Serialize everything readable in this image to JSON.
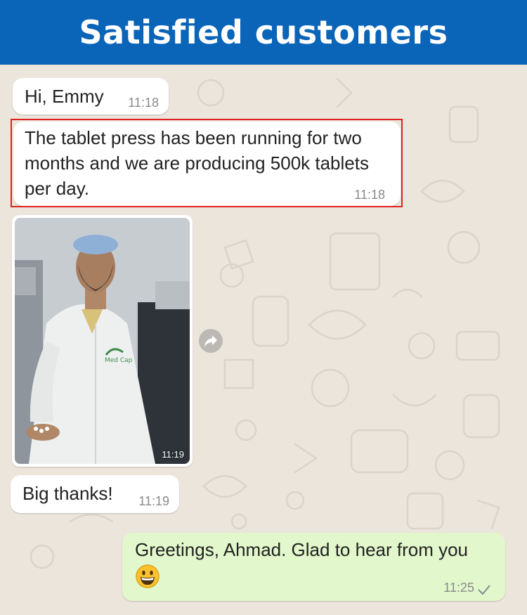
{
  "header": {
    "title": "Satisfied customers"
  },
  "chat": {
    "messages": [
      {
        "text": "Hi, Emmy",
        "time": "11:18",
        "direction": "incoming"
      },
      {
        "text": "The tablet press has been running for two months and we are producing 500k tablets per day.",
        "time": "11:18",
        "direction": "incoming",
        "highlighted": true
      },
      {
        "type": "image",
        "time": "11:19",
        "direction": "incoming",
        "logo_text": "Med Cap"
      },
      {
        "text": "Big thanks!",
        "time": "11:19",
        "direction": "incoming"
      },
      {
        "text": "Greetings, Ahmad. Glad to hear from you",
        "emoji": "grinning-face-emoji",
        "time": "11:25",
        "direction": "outgoing",
        "status_icon": "single-check-icon"
      }
    ]
  },
  "icons": {
    "forward": "forward-arrow-icon"
  },
  "colors": {
    "header_bg": "#0a64b8",
    "wallpaper": "#ece5dc",
    "incoming_bubble": "#ffffff",
    "outgoing_bubble": "#e2f7cb",
    "highlight_border": "#e02020"
  }
}
